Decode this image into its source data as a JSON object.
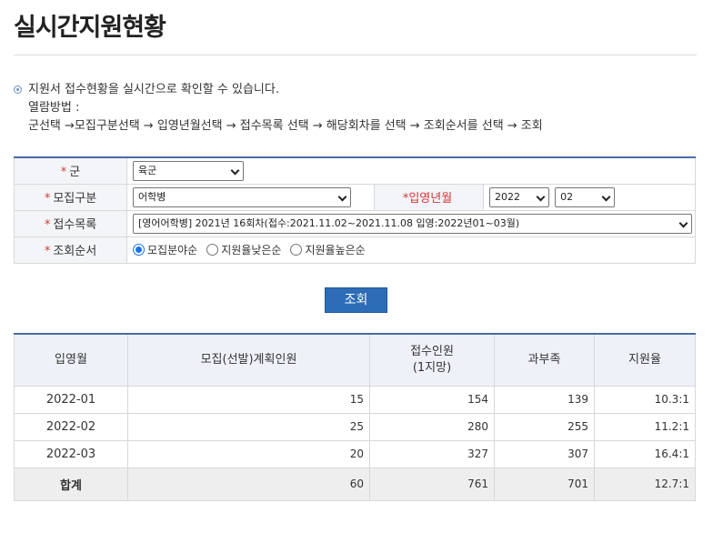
{
  "page": {
    "title": "실시간지원현황"
  },
  "info": {
    "description": "지원서 접수현황을 실시간으로 확인할 수 있습니다.",
    "method_label": "열람방법 :",
    "method_steps": "군선택 →모집구분선택 → 입영년월선택 → 접수목록 선택 → 해당회차를 선택 → 조회순서를 선택 → 조회"
  },
  "form": {
    "required_mark": "*",
    "branch": {
      "label": "군",
      "value": "육군"
    },
    "recruit_type": {
      "label": "모집구분",
      "value": "어학병"
    },
    "enlist_month": {
      "label": "*입영년월",
      "year": "2022",
      "month": "02"
    },
    "application_list": {
      "label": "접수목록",
      "value": "[영어어학병] 2021년 16회차(접수:2021.11.02~2021.11.08 입영:2022년01~03월)"
    },
    "sort_order": {
      "label": "조회순서",
      "options": [
        "모집분야순",
        "지원율낮은순",
        "지원율높은순"
      ],
      "selected": 0
    },
    "search_button": "조회"
  },
  "results": {
    "headers": [
      "입영월",
      "모집(선발)계획인원",
      "접수인원\n(1지망)",
      "과부족",
      "지원율"
    ],
    "rows": [
      {
        "month": "2022-01",
        "plan": "15",
        "applied": "154",
        "surplus": "139",
        "rate": "10.3:1"
      },
      {
        "month": "2022-02",
        "plan": "25",
        "applied": "280",
        "surplus": "255",
        "rate": "11.2:1"
      },
      {
        "month": "2022-03",
        "plan": "20",
        "applied": "327",
        "surplus": "307",
        "rate": "16.4:1"
      }
    ],
    "total": {
      "month": "합계",
      "plan": "60",
      "applied": "761",
      "surplus": "701",
      "rate": "12.7:1"
    }
  }
}
